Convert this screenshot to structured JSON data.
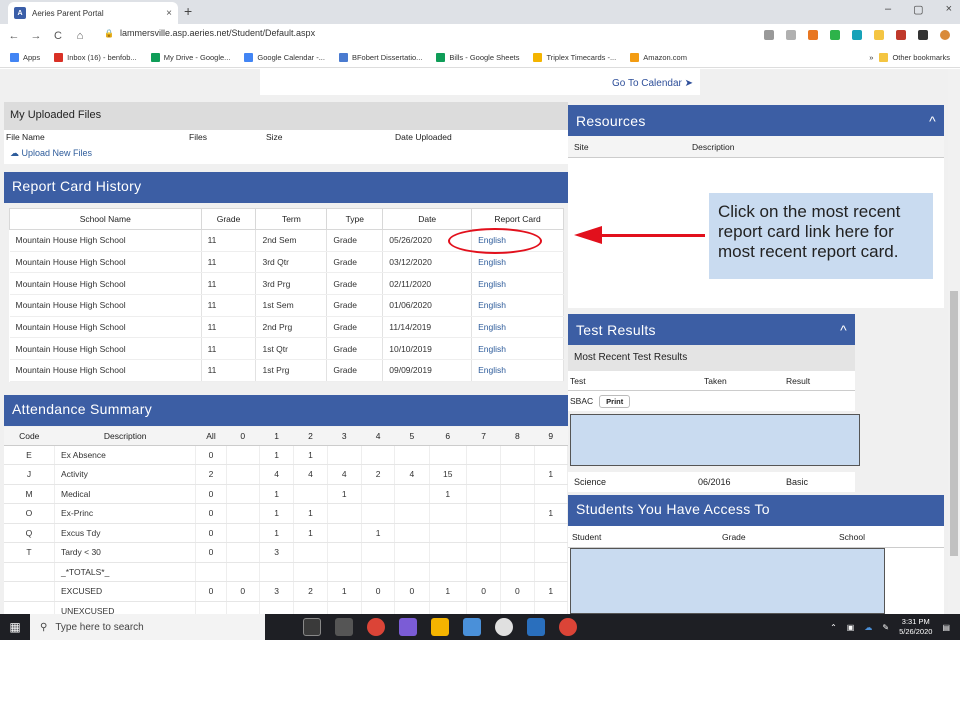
{
  "browser": {
    "tab_title": "Aeries Parent Portal",
    "tab_close": "×",
    "new_tab": "+",
    "url": "lammersville.asp.aeries.net/Student/Default.aspx",
    "window_controls": [
      "–",
      "▢",
      "×"
    ],
    "nav": [
      "←",
      "→",
      "C",
      "⌂"
    ],
    "bookmarks": [
      "Apps",
      "Inbox (16) - benfob...",
      "My Drive - Google...",
      "Google Calendar -...",
      "BFobert Dissertatio...",
      "Bills - Google Sheets",
      "Triplex Timecards -...",
      "Amazon.com"
    ],
    "bookmarks_more": "»",
    "other_bookmarks": "Other bookmarks"
  },
  "page": {
    "go_to_calendar": "Go To Calendar"
  },
  "files": {
    "title": "My Uploaded Files",
    "columns": [
      "File Name",
      "Files",
      "Size",
      "Date Uploaded"
    ],
    "upload_link": "Upload New Files"
  },
  "report_card_history": {
    "title": "Report Card History",
    "columns": [
      "School Name",
      "Grade",
      "Term",
      "Type",
      "Date",
      "Report Card"
    ],
    "rows": [
      [
        "Mountain House High School",
        "11",
        "2nd Sem",
        "Grade",
        "05/26/2020",
        "English"
      ],
      [
        "Mountain House High School",
        "11",
        "3rd Qtr",
        "Grade",
        "03/12/2020",
        "English"
      ],
      [
        "Mountain House High School",
        "11",
        "3rd Prg",
        "Grade",
        "02/11/2020",
        "English"
      ],
      [
        "Mountain House High School",
        "11",
        "1st Sem",
        "Grade",
        "01/06/2020",
        "English"
      ],
      [
        "Mountain House High School",
        "11",
        "2nd Prg",
        "Grade",
        "11/14/2019",
        "English"
      ],
      [
        "Mountain House High School",
        "11",
        "1st Qtr",
        "Grade",
        "10/10/2019",
        "English"
      ],
      [
        "Mountain House High School",
        "11",
        "1st Prg",
        "Grade",
        "09/09/2019",
        "English"
      ]
    ]
  },
  "attendance": {
    "title": "Attendance Summary",
    "columns": [
      "Code",
      "Description",
      "All",
      "0",
      "1",
      "2",
      "3",
      "4",
      "5",
      "6",
      "7",
      "8",
      "9"
    ],
    "rows": [
      [
        "E",
        "Ex Absence",
        "0",
        "",
        "1",
        "1",
        "",
        "",
        "",
        "",
        "",
        "",
        ""
      ],
      [
        "J",
        "Activity",
        "2",
        "",
        "4",
        "4",
        "4",
        "2",
        "4",
        "15",
        "",
        "",
        "1"
      ],
      [
        "M",
        "Medical",
        "0",
        "",
        "1",
        "",
        "1",
        "",
        "",
        "1",
        "",
        "",
        ""
      ],
      [
        "O",
        "Ex-Princ",
        "0",
        "",
        "1",
        "1",
        "",
        "",
        "",
        "",
        "",
        "",
        "1"
      ],
      [
        "Q",
        "Excus Tdy",
        "0",
        "",
        "1",
        "1",
        "",
        "1",
        "",
        "",
        "",
        "",
        ""
      ],
      [
        "T",
        "Tardy < 30",
        "0",
        "",
        "3",
        "",
        "",
        "",
        "",
        "",
        "",
        "",
        ""
      ],
      [
        "",
        "_*TOTALS*_",
        "",
        "",
        "",
        "",
        "",
        "",
        "",
        "",
        "",
        "",
        ""
      ],
      [
        "",
        "EXCUSED",
        "0",
        "0",
        "3",
        "2",
        "1",
        "0",
        "0",
        "1",
        "0",
        "0",
        "1"
      ],
      [
        "",
        "UNEXCUSED",
        "",
        "",
        "",
        "",
        "",
        "",
        "",
        "",
        "",
        "",
        ""
      ]
    ]
  },
  "resources": {
    "title": "Resources",
    "collapse": "^",
    "columns": [
      "Site",
      "Description"
    ]
  },
  "callout": {
    "text": "Click on the most recent report card link here for most recent report card."
  },
  "test_results": {
    "title": "Test Results",
    "collapse": "^",
    "subtitle": "Most Recent Test Results",
    "columns": [
      "Test",
      "Taken",
      "Result"
    ],
    "sbac_label": "SBAC",
    "print_label": "Print",
    "science_row": [
      "Science",
      "06/2016",
      "Basic"
    ]
  },
  "students": {
    "title": "Students You Have Access To",
    "columns": [
      "Student",
      "Grade",
      "School"
    ]
  },
  "taskbar": {
    "search_placeholder": "Type here to search",
    "time": "3:31 PM",
    "date": "5/26/2020"
  },
  "colors": {
    "header_blue": "#3c5ea4",
    "link_blue": "#2e5c9b",
    "annotation_red": "#e2101c",
    "callout_fill": "#c9dbf0"
  }
}
